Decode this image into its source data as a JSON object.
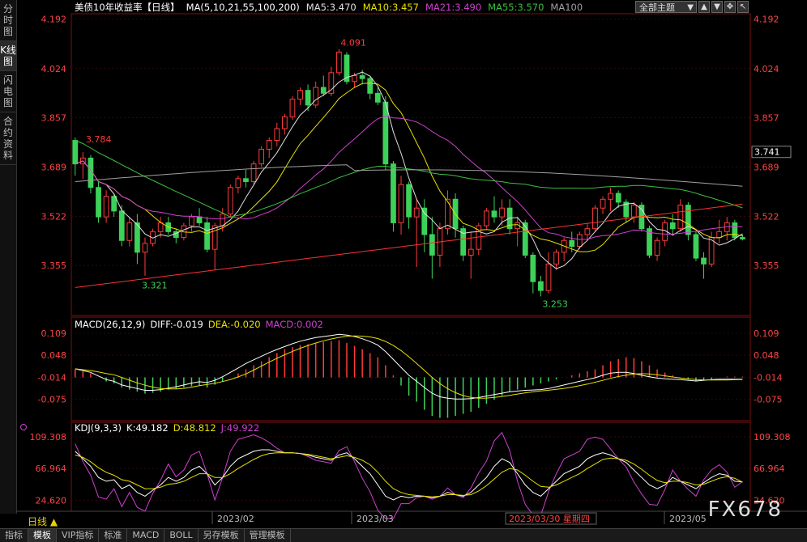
{
  "left_tabs": [
    "分时图",
    "K线图",
    "闪电图",
    "合约资料"
  ],
  "active_left_tab": 1,
  "header": {
    "title": "美债10年收益率【日线】",
    "ma_label": "MA(5,10,21,55,100,200)",
    "ma5": "MA5:3.470",
    "ma10": "MA10:3.457",
    "ma21": "MA21:3.490",
    "ma55": "MA55:3.570",
    "ma100": "MA100",
    "theme_select": "全部主题"
  },
  "colors": {
    "up": "#ff3b3b",
    "down": "#3cd25a",
    "ma5": "#e0e0e0",
    "ma10": "#e8e000",
    "ma21": "#d040d0",
    "ma55": "#3cc03c",
    "ma100": "#a0a0a0",
    "ma200": "#ff3030",
    "axis_text": "#ff4444",
    "frame": "#7a1010"
  },
  "price_axis": {
    "ticks": [
      "4.192",
      "4.024",
      "3.857",
      "3.689",
      "3.522",
      "3.355"
    ],
    "current": "3.741"
  },
  "annotations": {
    "high_jan": "3.784",
    "low_jan": "3.321",
    "high_mar": "4.091",
    "low_mar": "3.253"
  },
  "macd": {
    "label": "MACD(26,12,9)",
    "diff": "DIFF:-0.019",
    "dea": "DEA:-0.020",
    "macd": "MACD:0.002",
    "ticks": [
      "0.109",
      "0.048",
      "-0.014",
      "-0.075"
    ]
  },
  "kdj": {
    "label": "KDJ(9,3,3)",
    "k": "K:49.182",
    "d": "D:48.812",
    "j": "J:49.922",
    "ticks": [
      "109.308",
      "66.964",
      "24.620"
    ]
  },
  "time_axis": {
    "period": "日线",
    "labels": [
      "2023/02",
      "2023/03",
      "2023/05"
    ],
    "crosshair_date": "2023/03/30 星期四"
  },
  "bottom_tabs": [
    "指标",
    "模板",
    "VIP指标",
    "标准",
    "MACD",
    "BOLL",
    "另存模板",
    "管理模板"
  ],
  "active_bottom_tab": 1,
  "watermark": "FX678",
  "chart_data": {
    "type": "candlestick",
    "series_ohlc": [
      {
        "o": 3.78,
        "h": 3.79,
        "l": 3.66,
        "c": 3.7
      },
      {
        "o": 3.7,
        "h": 3.74,
        "l": 3.65,
        "c": 3.72
      },
      {
        "o": 3.72,
        "h": 3.73,
        "l": 3.6,
        "c": 3.62
      },
      {
        "o": 3.62,
        "h": 3.64,
        "l": 3.5,
        "c": 3.52
      },
      {
        "o": 3.52,
        "h": 3.61,
        "l": 3.5,
        "c": 3.59
      },
      {
        "o": 3.59,
        "h": 3.6,
        "l": 3.52,
        "c": 3.54
      },
      {
        "o": 3.54,
        "h": 3.56,
        "l": 3.42,
        "c": 3.44
      },
      {
        "o": 3.44,
        "h": 3.52,
        "l": 3.42,
        "c": 3.5
      },
      {
        "o": 3.5,
        "h": 3.53,
        "l": 3.36,
        "c": 3.4
      },
      {
        "o": 3.4,
        "h": 3.45,
        "l": 3.32,
        "c": 3.43
      },
      {
        "o": 3.43,
        "h": 3.48,
        "l": 3.42,
        "c": 3.47
      },
      {
        "o": 3.47,
        "h": 3.52,
        "l": 3.45,
        "c": 3.5
      },
      {
        "o": 3.5,
        "h": 3.52,
        "l": 3.46,
        "c": 3.47
      },
      {
        "o": 3.47,
        "h": 3.48,
        "l": 3.43,
        "c": 3.45
      },
      {
        "o": 3.45,
        "h": 3.5,
        "l": 3.44,
        "c": 3.49
      },
      {
        "o": 3.49,
        "h": 3.53,
        "l": 3.47,
        "c": 3.52
      },
      {
        "o": 3.52,
        "h": 3.55,
        "l": 3.49,
        "c": 3.5
      },
      {
        "o": 3.5,
        "h": 3.52,
        "l": 3.4,
        "c": 3.41
      },
      {
        "o": 3.41,
        "h": 3.5,
        "l": 3.34,
        "c": 3.49
      },
      {
        "o": 3.49,
        "h": 3.55,
        "l": 3.47,
        "c": 3.53
      },
      {
        "o": 3.53,
        "h": 3.63,
        "l": 3.52,
        "c": 3.62
      },
      {
        "o": 3.62,
        "h": 3.66,
        "l": 3.6,
        "c": 3.65
      },
      {
        "o": 3.65,
        "h": 3.68,
        "l": 3.62,
        "c": 3.64
      },
      {
        "o": 3.64,
        "h": 3.71,
        "l": 3.63,
        "c": 3.7
      },
      {
        "o": 3.7,
        "h": 3.76,
        "l": 3.69,
        "c": 3.75
      },
      {
        "o": 3.75,
        "h": 3.79,
        "l": 3.72,
        "c": 3.78
      },
      {
        "o": 3.78,
        "h": 3.84,
        "l": 3.76,
        "c": 3.82
      },
      {
        "o": 3.82,
        "h": 3.87,
        "l": 3.8,
        "c": 3.86
      },
      {
        "o": 3.86,
        "h": 3.93,
        "l": 3.85,
        "c": 3.92
      },
      {
        "o": 3.92,
        "h": 3.96,
        "l": 3.9,
        "c": 3.95
      },
      {
        "o": 3.95,
        "h": 3.97,
        "l": 3.88,
        "c": 3.9
      },
      {
        "o": 3.9,
        "h": 3.98,
        "l": 3.89,
        "c": 3.96
      },
      {
        "o": 3.96,
        "h": 4.0,
        "l": 3.93,
        "c": 3.94
      },
      {
        "o": 3.94,
        "h": 4.03,
        "l": 3.93,
        "c": 4.01
      },
      {
        "o": 4.01,
        "h": 4.09,
        "l": 4.0,
        "c": 4.08
      },
      {
        "o": 4.07,
        "h": 4.08,
        "l": 3.97,
        "c": 3.98
      },
      {
        "o": 3.98,
        "h": 4.01,
        "l": 3.96,
        "c": 4.0
      },
      {
        "o": 4.0,
        "h": 4.02,
        "l": 3.97,
        "c": 3.99
      },
      {
        "o": 3.99,
        "h": 4.0,
        "l": 3.92,
        "c": 3.94
      },
      {
        "o": 3.94,
        "h": 3.96,
        "l": 3.9,
        "c": 3.91
      },
      {
        "o": 3.91,
        "h": 3.93,
        "l": 3.68,
        "c": 3.7
      },
      {
        "o": 3.7,
        "h": 3.71,
        "l": 3.47,
        "c": 3.5
      },
      {
        "o": 3.5,
        "h": 3.66,
        "l": 3.46,
        "c": 3.63
      },
      {
        "o": 3.63,
        "h": 3.64,
        "l": 3.48,
        "c": 3.52
      },
      {
        "o": 3.52,
        "h": 3.58,
        "l": 3.35,
        "c": 3.55
      },
      {
        "o": 3.55,
        "h": 3.58,
        "l": 3.4,
        "c": 3.46
      },
      {
        "o": 3.46,
        "h": 3.52,
        "l": 3.31,
        "c": 3.39
      },
      {
        "o": 3.39,
        "h": 3.5,
        "l": 3.35,
        "c": 3.48
      },
      {
        "o": 3.48,
        "h": 3.61,
        "l": 3.46,
        "c": 3.58
      },
      {
        "o": 3.58,
        "h": 3.6,
        "l": 3.45,
        "c": 3.48
      },
      {
        "o": 3.48,
        "h": 3.49,
        "l": 3.37,
        "c": 3.39
      },
      {
        "o": 3.39,
        "h": 3.47,
        "l": 3.31,
        "c": 3.41
      },
      {
        "o": 3.41,
        "h": 3.5,
        "l": 3.39,
        "c": 3.49
      },
      {
        "o": 3.49,
        "h": 3.55,
        "l": 3.48,
        "c": 3.54
      },
      {
        "o": 3.54,
        "h": 3.59,
        "l": 3.5,
        "c": 3.52
      },
      {
        "o": 3.52,
        "h": 3.58,
        "l": 3.49,
        "c": 3.55
      },
      {
        "o": 3.55,
        "h": 3.58,
        "l": 3.46,
        "c": 3.48
      },
      {
        "o": 3.48,
        "h": 3.52,
        "l": 3.42,
        "c": 3.5
      },
      {
        "o": 3.5,
        "h": 3.51,
        "l": 3.38,
        "c": 3.39
      },
      {
        "o": 3.39,
        "h": 3.4,
        "l": 3.26,
        "c": 3.3
      },
      {
        "o": 3.3,
        "h": 3.32,
        "l": 3.25,
        "c": 3.27
      },
      {
        "o": 3.27,
        "h": 3.4,
        "l": 3.26,
        "c": 3.36
      },
      {
        "o": 3.36,
        "h": 3.41,
        "l": 3.34,
        "c": 3.4
      },
      {
        "o": 3.4,
        "h": 3.45,
        "l": 3.37,
        "c": 3.44
      },
      {
        "o": 3.44,
        "h": 3.47,
        "l": 3.4,
        "c": 3.42
      },
      {
        "o": 3.42,
        "h": 3.47,
        "l": 3.41,
        "c": 3.46
      },
      {
        "o": 3.46,
        "h": 3.5,
        "l": 3.44,
        "c": 3.48
      },
      {
        "o": 3.48,
        "h": 3.56,
        "l": 3.47,
        "c": 3.55
      },
      {
        "o": 3.55,
        "h": 3.59,
        "l": 3.53,
        "c": 3.58
      },
      {
        "o": 3.58,
        "h": 3.62,
        "l": 3.54,
        "c": 3.6
      },
      {
        "o": 3.6,
        "h": 3.61,
        "l": 3.55,
        "c": 3.57
      },
      {
        "o": 3.57,
        "h": 3.58,
        "l": 3.5,
        "c": 3.52
      },
      {
        "o": 3.52,
        "h": 3.57,
        "l": 3.5,
        "c": 3.56
      },
      {
        "o": 3.56,
        "h": 3.57,
        "l": 3.47,
        "c": 3.48
      },
      {
        "o": 3.48,
        "h": 3.49,
        "l": 3.38,
        "c": 3.39
      },
      {
        "o": 3.39,
        "h": 3.45,
        "l": 3.37,
        "c": 3.44
      },
      {
        "o": 3.44,
        "h": 3.51,
        "l": 3.42,
        "c": 3.5
      },
      {
        "o": 3.5,
        "h": 3.53,
        "l": 3.46,
        "c": 3.48
      },
      {
        "o": 3.48,
        "h": 3.58,
        "l": 3.47,
        "c": 3.56
      },
      {
        "o": 3.56,
        "h": 3.57,
        "l": 3.44,
        "c": 3.46
      },
      {
        "o": 3.46,
        "h": 3.47,
        "l": 3.37,
        "c": 3.38
      },
      {
        "o": 3.38,
        "h": 3.4,
        "l": 3.31,
        "c": 3.36
      },
      {
        "o": 3.36,
        "h": 3.47,
        "l": 3.35,
        "c": 3.45
      },
      {
        "o": 3.45,
        "h": 3.51,
        "l": 3.43,
        "c": 3.47
      },
      {
        "o": 3.47,
        "h": 3.52,
        "l": 3.44,
        "c": 3.5
      },
      {
        "o": 3.5,
        "h": 3.51,
        "l": 3.44,
        "c": 3.45
      },
      {
        "o": 3.45,
        "h": 3.46,
        "l": 3.44,
        "c": 3.445
      }
    ],
    "macd_hist": [
      0.02,
      0.015,
      0.01,
      0.0,
      -0.01,
      -0.015,
      -0.025,
      -0.03,
      -0.035,
      -0.04,
      -0.038,
      -0.035,
      -0.03,
      -0.028,
      -0.025,
      -0.022,
      -0.02,
      -0.025,
      -0.018,
      -0.01,
      0.0,
      0.01,
      0.02,
      0.03,
      0.04,
      0.05,
      0.06,
      0.07,
      0.075,
      0.08,
      0.082,
      0.085,
      0.088,
      0.09,
      0.092,
      0.085,
      0.078,
      0.07,
      0.06,
      0.05,
      0.03,
      0.005,
      -0.02,
      -0.045,
      -0.06,
      -0.08,
      -0.095,
      -0.1,
      -0.1,
      -0.095,
      -0.09,
      -0.085,
      -0.075,
      -0.065,
      -0.055,
      -0.045,
      -0.035,
      -0.03,
      -0.025,
      -0.02,
      -0.015,
      -0.01,
      -0.005,
      0.0,
      0.005,
      0.01,
      0.015,
      0.02,
      0.03,
      0.04,
      0.045,
      0.05,
      0.048,
      0.04,
      0.03,
      0.02,
      0.012,
      0.005,
      0.0,
      -0.005,
      -0.01,
      -0.008,
      -0.004,
      0.0,
      0.002,
      0.002,
      0.002
    ],
    "kdj_k": [
      90,
      80,
      70,
      55,
      50,
      52,
      40,
      45,
      35,
      30,
      38,
      45,
      55,
      50,
      55,
      65,
      70,
      60,
      45,
      55,
      70,
      80,
      85,
      90,
      92,
      92,
      90,
      88,
      88,
      87,
      85,
      82,
      80,
      78,
      85,
      88,
      80,
      70,
      60,
      45,
      30,
      25,
      30,
      28,
      30,
      30,
      28,
      30,
      35,
      32,
      30,
      35,
      45,
      55,
      70,
      80,
      75,
      60,
      45,
      35,
      30,
      40,
      50,
      60,
      65,
      70,
      80,
      85,
      88,
      85,
      80,
      75,
      65,
      55,
      45,
      40,
      45,
      55,
      50,
      45,
      40,
      48,
      55,
      60,
      58,
      50,
      49
    ],
    "kdj_d": [
      85,
      82,
      76,
      68,
      62,
      58,
      52,
      50,
      45,
      40,
      40,
      42,
      46,
      47,
      50,
      55,
      60,
      60,
      55,
      55,
      60,
      67,
      73,
      79,
      84,
      87,
      88,
      88,
      88,
      87,
      86,
      84,
      82,
      80,
      82,
      84,
      82,
      78,
      72,
      62,
      50,
      40,
      35,
      32,
      31,
      30,
      29,
      30,
      32,
      32,
      31,
      32,
      37,
      44,
      53,
      62,
      67,
      65,
      58,
      50,
      43,
      42,
      45,
      50,
      55,
      60,
      67,
      73,
      79,
      81,
      80,
      78,
      73,
      66,
      58,
      51,
      48,
      50,
      50,
      48,
      45,
      46,
      50,
      54,
      56,
      54,
      48.8
    ],
    "macd_diff": [
      0.01,
      0.005,
      0.0,
      -0.01,
      -0.02,
      -0.025,
      -0.035,
      -0.04,
      -0.045,
      -0.05,
      -0.05,
      -0.048,
      -0.044,
      -0.04,
      -0.035,
      -0.03,
      -0.026,
      -0.028,
      -0.022,
      -0.012,
      0.0,
      0.012,
      0.025,
      0.035,
      0.045,
      0.055,
      0.064,
      0.072,
      0.08,
      0.087,
      0.092,
      0.097,
      0.1,
      0.103,
      0.106,
      0.104,
      0.1,
      0.094,
      0.086,
      0.076,
      0.058,
      0.036,
      0.014,
      -0.008,
      -0.025,
      -0.042,
      -0.058,
      -0.068,
      -0.072,
      -0.074,
      -0.074,
      -0.073,
      -0.07,
      -0.066,
      -0.062,
      -0.058,
      -0.054,
      -0.052,
      -0.05,
      -0.049,
      -0.048,
      -0.045,
      -0.04,
      -0.035,
      -0.03,
      -0.025,
      -0.02,
      -0.015,
      -0.008,
      -0.002,
      0.0,
      0.0,
      -0.003,
      -0.008,
      -0.012,
      -0.016,
      -0.018,
      -0.019,
      -0.02,
      -0.022,
      -0.024,
      -0.022,
      -0.02,
      -0.019,
      -0.019,
      -0.019,
      -0.019
    ]
  }
}
